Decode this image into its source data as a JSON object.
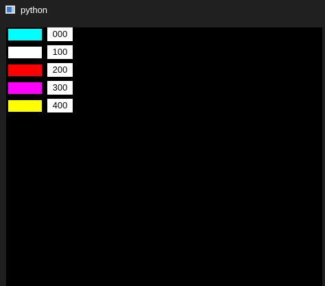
{
  "window": {
    "title": "python"
  },
  "rows": [
    {
      "color": "#00ffff",
      "value": "000"
    },
    {
      "color": "#ffffff",
      "value": "100"
    },
    {
      "color": "#ff0000",
      "value": "200"
    },
    {
      "color": "#ff00ff",
      "value": "300"
    },
    {
      "color": "#ffff00",
      "value": "400"
    }
  ]
}
